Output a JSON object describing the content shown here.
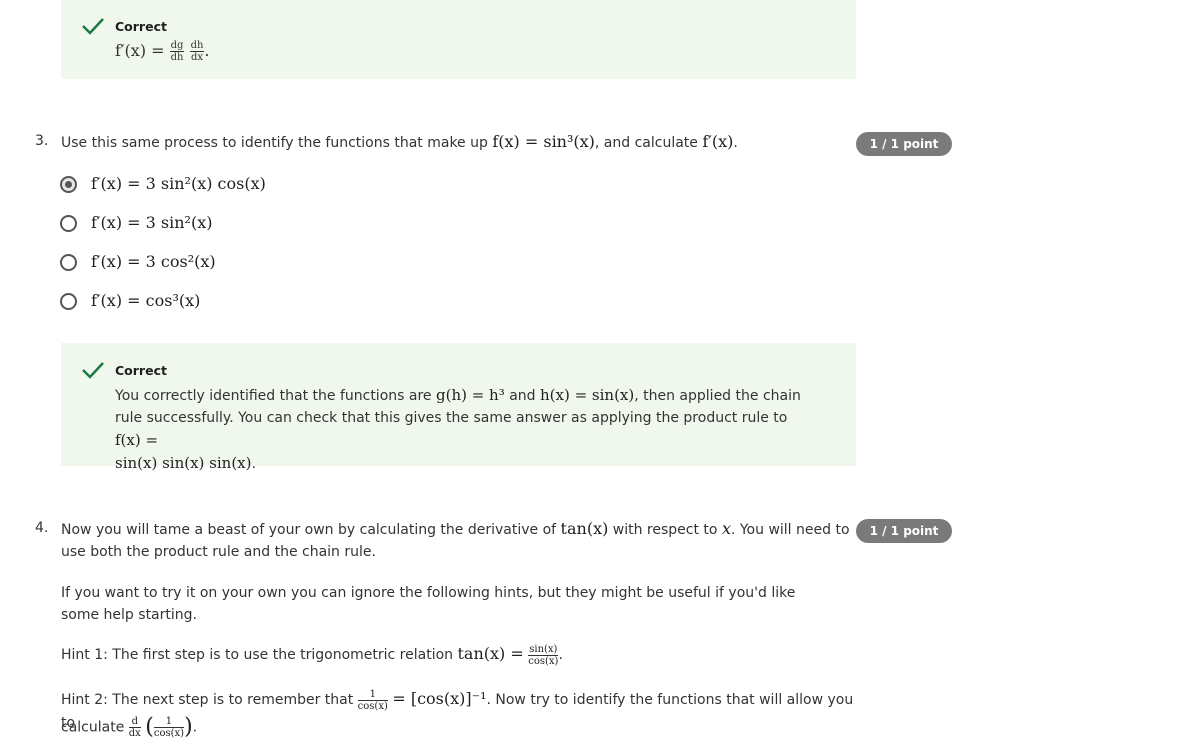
{
  "feedback_top": {
    "title": "Correct",
    "formula_lhs": "f′(x) =",
    "frac1_num": "dg",
    "frac1_den": "dh",
    "frac2_num": "dh",
    "frac2_den": "dx",
    "end": "."
  },
  "q3": {
    "number": "3.",
    "text_before": "Use this same process to identify the functions that make up",
    "formula1": "f(x) = sin³(x)",
    "text_middle": ", and calculate",
    "formula2": "f′(x)",
    "text_end": ".",
    "points": "1 / 1 point",
    "options": [
      {
        "label": "f′(x) = 3 sin²(x) cos(x)",
        "selected": true
      },
      {
        "label": "f′(x) = 3 sin²(x)",
        "selected": false
      },
      {
        "label": "f′(x) = 3 cos²(x)",
        "selected": false
      },
      {
        "label": "f′(x) = cos³(x)",
        "selected": false
      }
    ],
    "feedback": {
      "title": "Correct",
      "t1": "You correctly identified that the functions are",
      "m1": "g(h) = h³",
      "t2": "and",
      "m2": "h(x) = sin(x)",
      "t3": ", then applied the chain rule successfully. You can check that this gives the same answer as applying the product rule to",
      "m3": "f(x) =",
      "m4": "sin(x) sin(x) sin(x)",
      "t4": "."
    }
  },
  "q4": {
    "number": "4.",
    "points": "1 / 1 point",
    "t1": "Now you will tame a beast of your own by calculating the derivative of",
    "m1": "tan(x)",
    "t2": "with respect to",
    "m2": "x",
    "t3": ". You will need to use both the product rule and the chain rule.",
    "p2": "If you want to try it on your own you can ignore the following hints, but they might be useful if you'd like some help starting.",
    "hint1_text": "Hint 1: The first step is to use the trigonometric relation",
    "hint1_lhs": "tan(x) =",
    "hint1_num": "sin(x)",
    "hint1_den": "cos(x)",
    "hint2_text": "Hint 2: The next step is to remember that",
    "hint2_num": "1",
    "hint2_den": "cos(x)",
    "hint2_rhs": "= [cos(x)]⁻¹",
    "hint2_after": ". Now try to identify the functions that will allow you to",
    "hint2_calc": "calculate",
    "hint2_d_num": "d",
    "hint2_d_den": "dx",
    "hint2_in_num": "1",
    "hint2_in_den": "cos(x)"
  },
  "colors": {
    "feedback_bg": "#f0f8ee",
    "check": "#1e7a3e",
    "badge_bg": "#7a7a7a"
  }
}
